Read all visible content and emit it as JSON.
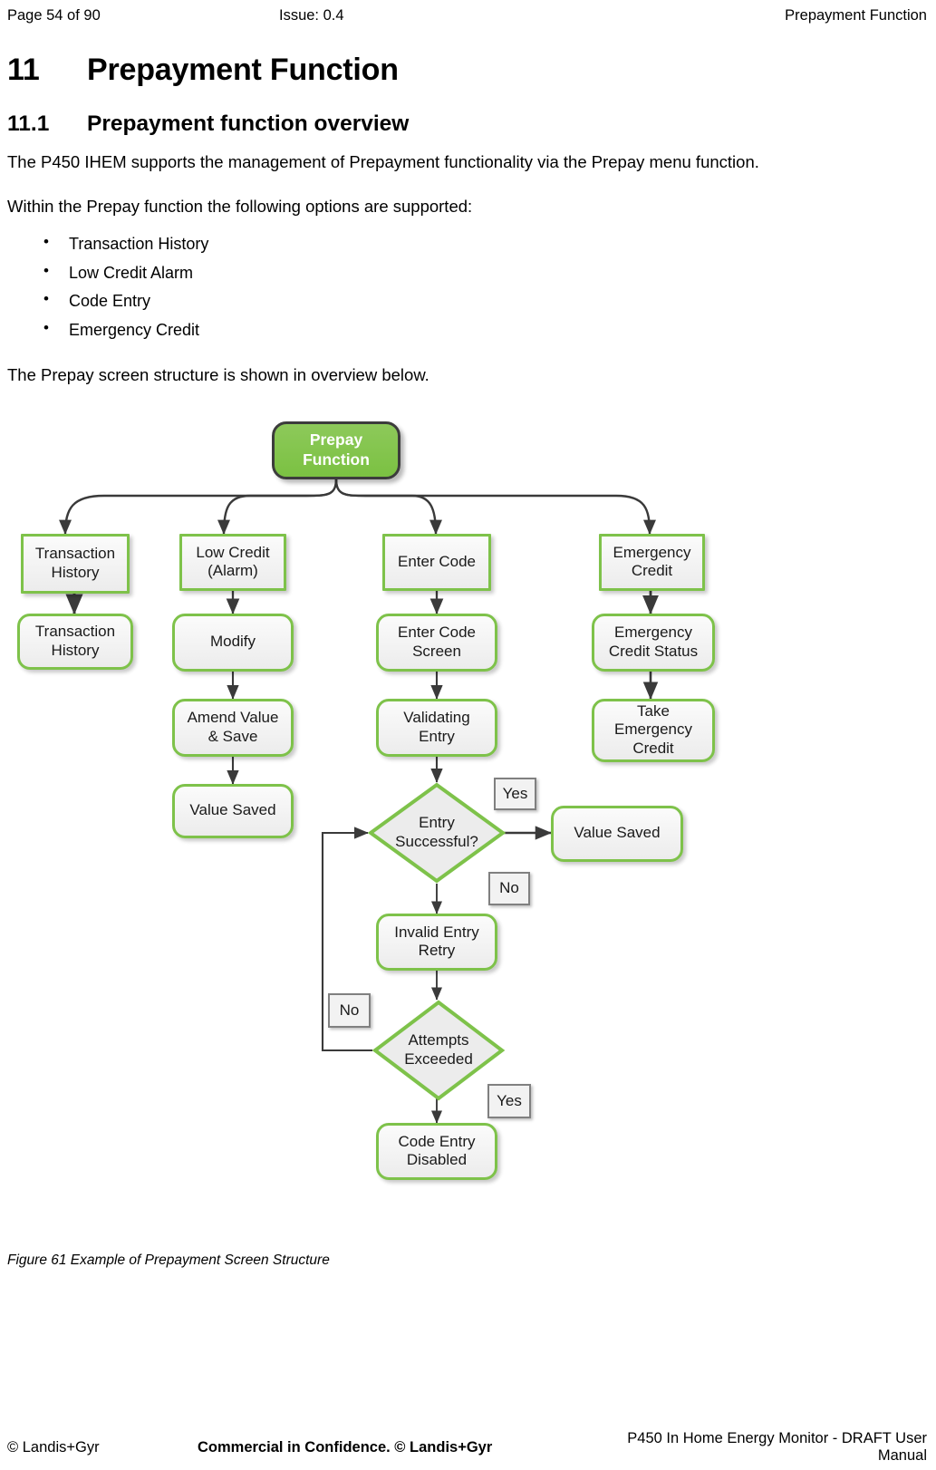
{
  "header": {
    "page_label": "Page 54 of 90",
    "issue": "Issue: 0.4",
    "doc_section": "Prepayment Function"
  },
  "section": {
    "number": "11",
    "title": "Prepayment Function"
  },
  "subsection": {
    "number": "11.1",
    "title": "Prepayment function overview"
  },
  "paragraphs": {
    "intro": "The P450 IHEM supports the management of Prepayment functionality via the Prepay menu function.",
    "options_lead": "Within the Prepay function the following options are supported:",
    "figure_lead": "The Prepay screen structure is shown in overview below."
  },
  "bullets": [
    {
      "marker": "•",
      "label": "Transaction History"
    },
    {
      "marker": "•",
      "label": "Low Credit Alarm"
    },
    {
      "marker": "•",
      "label": "Code Entry"
    },
    {
      "marker": "•",
      "label": "Emergency Credit"
    }
  ],
  "figure": {
    "caption": "Figure 61 Example of Prepayment Screen Structure",
    "colors": {
      "node_border_green": "#7ec24a",
      "root_fill_green": "#7bc142",
      "root_border_dark": "#3c3c3c",
      "node_fill_grey": "#ececec",
      "tag_border_grey": "#808080",
      "connector": "#333333"
    },
    "root": {
      "line1": "Prepay",
      "line2": "Function"
    },
    "branches": [
      {
        "head": {
          "line1": "Transaction",
          "line2": "History"
        },
        "steps": [
          {
            "line1": "Transaction",
            "line2": "History"
          }
        ]
      },
      {
        "head": {
          "line1": "Low Credit",
          "line2": "(Alarm)"
        },
        "steps": [
          {
            "line1": "Modify",
            "line2": ""
          },
          {
            "line1": "Amend Value",
            "line2": "& Save"
          },
          {
            "line1": "Value Saved",
            "line2": ""
          }
        ]
      },
      {
        "head": {
          "line1": "Enter Code",
          "line2": ""
        },
        "steps": [
          {
            "line1": "Enter Code",
            "line2": "Screen"
          },
          {
            "line1": "Validating",
            "line2": "Entry"
          }
        ]
      },
      {
        "head": {
          "line1": "Emergency",
          "line2": "Credit"
        },
        "steps": [
          {
            "line1": "Emergency",
            "line2": "Credit Status"
          },
          {
            "line1": "Take",
            "line2": "Emergency",
            "line3": "Credit"
          }
        ]
      }
    ],
    "decisions": {
      "entry_successful": {
        "line1": "Entry",
        "line2": "Successful?"
      },
      "attempts_exceeded": {
        "line1": "Attempts",
        "line2": "Exceeded"
      }
    },
    "outcomes": {
      "value_saved": "Value Saved",
      "invalid_entry": {
        "line1": "Invalid Entry",
        "line2": "Retry"
      },
      "code_entry_disabled": {
        "line1": "Code Entry",
        "line2": "Disabled"
      }
    },
    "tags": {
      "entry_yes": "Yes",
      "entry_no": "No",
      "attempts_no": "No",
      "attempts_yes": "Yes"
    }
  },
  "footer": {
    "left": "© Landis+Gyr",
    "center": "Commercial in Confidence. © Landis+Gyr",
    "right": "P450 In Home Energy Monitor - DRAFT User Manual"
  }
}
